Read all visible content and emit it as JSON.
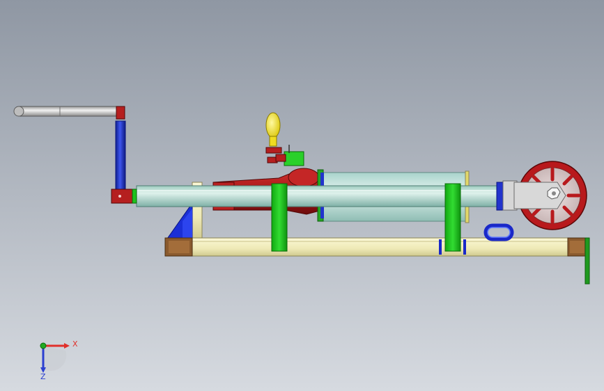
{
  "viewport": {
    "background_top": "#8f97a3",
    "background_bottom": "#d6dae0"
  },
  "triad": {
    "x_label": "X",
    "z_label": "Z",
    "x_color": "#e0302a",
    "y_color": "#22aa22",
    "z_color": "#2b3fd0"
  },
  "colors": {
    "frame_rail": "#f3efbf",
    "frame_edge": "#8b8455",
    "end_block": "#8a5a2e",
    "clamp_green": "#1ec21e",
    "cylinder_cyan": "#bfe3dc",
    "pump_red": "#b51f1f",
    "crank_blue": "#2233cc",
    "handle_yellow": "#f1e21a",
    "wheel_red": "#b8191c",
    "metal_gray": "#cfcfcf"
  }
}
